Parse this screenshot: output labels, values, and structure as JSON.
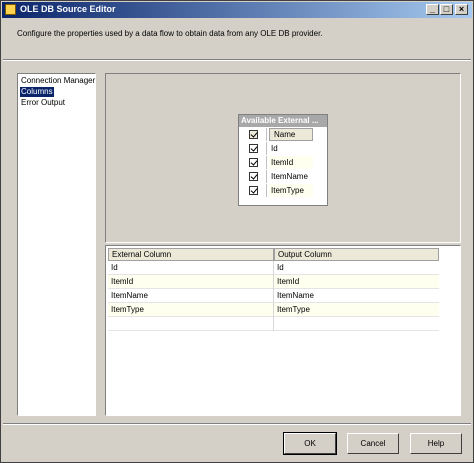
{
  "window": {
    "title": "OLE DB Source Editor",
    "controls": [
      "_",
      "□",
      "×"
    ]
  },
  "description": "Configure the properties used by a data flow to obtain data from any OLE DB provider.",
  "nav": {
    "items": [
      {
        "label": "Connection Manager",
        "selected": false
      },
      {
        "label": "Columns",
        "selected": true
      },
      {
        "label": "Error Output",
        "selected": false
      }
    ]
  },
  "available_columns": {
    "title": "Available External ...",
    "header": "Name",
    "rows": [
      {
        "name": "Id",
        "checked": true
      },
      {
        "name": "ItemId",
        "checked": true
      },
      {
        "name": "ItemName",
        "checked": true
      },
      {
        "name": "ItemType",
        "checked": true
      }
    ]
  },
  "mapping_grid": {
    "headers": [
      "External Column",
      "Output Column"
    ],
    "rows": [
      [
        "Id",
        "Id"
      ],
      [
        "ItemId",
        "ItemId"
      ],
      [
        "ItemName",
        "ItemName"
      ],
      [
        "ItemType",
        "ItemType"
      ]
    ]
  },
  "buttons": {
    "ok": "OK",
    "cancel": "Cancel",
    "help": "Help"
  },
  "colors": {
    "title_start": "#0a246a",
    "title_end": "#a6caf0",
    "selection": "#0a246a",
    "face": "#d4d0c8"
  }
}
